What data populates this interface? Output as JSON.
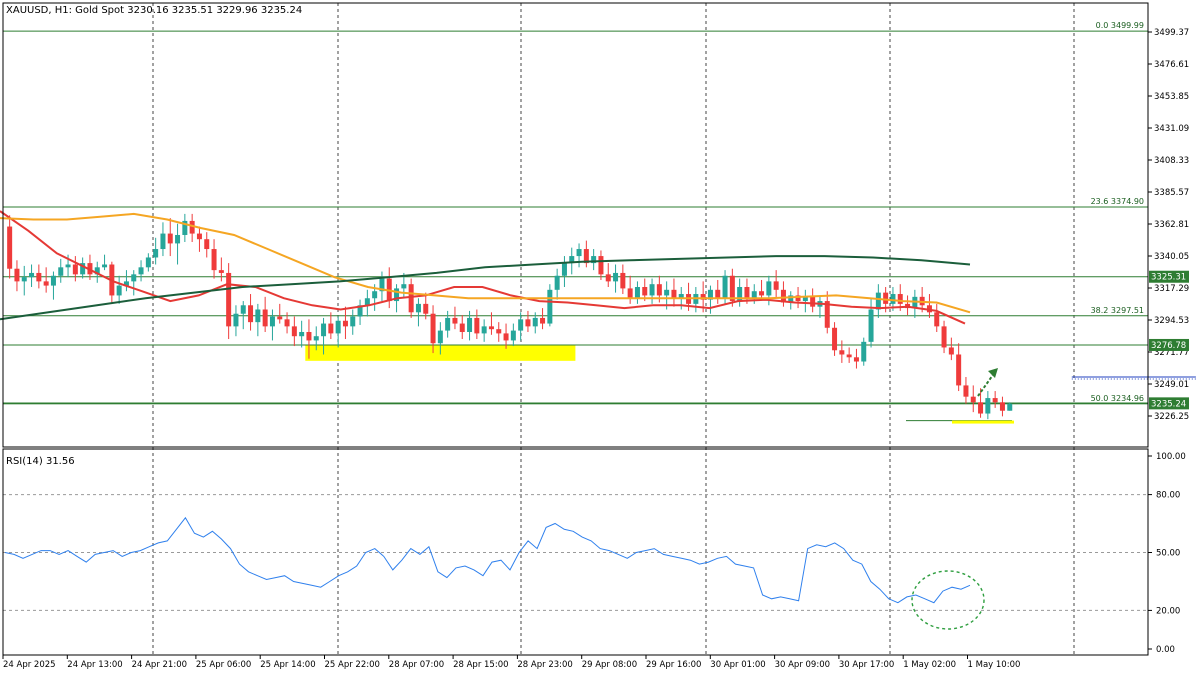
{
  "header": {
    "symbol_line": "XAUUSD, H1:  Gold Spot  3230.16 3235.51 3229.96 3235.24"
  },
  "colors": {
    "bull": "#26a69a",
    "bear": "#ef3b3b",
    "ma_fast": "#e53935",
    "ma_mid": "#f5a623",
    "ma_slow": "#1b5e3b",
    "fib": "#2e7d32",
    "zone": "#ffff00",
    "rsi": "#2f80ed",
    "arrow": "#2e7d32",
    "range_line": "#1f3fbf"
  },
  "chart_data": [
    {
      "type": "candlestick",
      "title": "XAUUSD, H1:  Gold Spot  3230.16 3235.51 3229.96 3235.24",
      "ylim": [
        3215,
        3515
      ],
      "y_ticks": [
        "3499.37",
        "3476.61",
        "3453.85",
        "3431.09",
        "3408.33",
        "3385.57",
        "3362.81",
        "3340.05",
        "3317.29",
        "3294.53",
        "3271.77",
        "3249.01",
        "3226.25"
      ],
      "x_ticks": [
        "24 Apr 2025",
        "24 Apr 13:00",
        "24 Apr 21:00",
        "25 Apr 06:00",
        "25 Apr 14:00",
        "25 Apr 22:00",
        "28 Apr 07:00",
        "28 Apr 15:00",
        "28 Apr 23:00",
        "29 Apr 08:00",
        "29 Apr 16:00",
        "30 Apr 01:00",
        "30 Apr 09:00",
        "30 Apr 17:00",
        "1 May 02:00",
        "1 May 10:00"
      ],
      "price_labels": [
        {
          "text": "3325.31",
          "value": 3325.31
        },
        {
          "text": "3276.78",
          "value": 3276.78
        },
        {
          "text": "3235.24",
          "value": 3235.24
        }
      ],
      "fib_levels": [
        {
          "label": "0.0 3499.99",
          "value": 3499.99
        },
        {
          "label": "23.6 3374.90",
          "value": 3374.9
        },
        {
          "label": "38.2 3297.51",
          "value": 3297.51
        },
        {
          "label": "50.0 3234.96",
          "value": 3234.96
        }
      ],
      "support_zone": {
        "from_bar": 41,
        "to_bar": 78,
        "y_low": 3265.5,
        "y_high": 3276.5
      },
      "range_line": {
        "from_bar": 146,
        "to_bar": 163,
        "value": 3254.0
      },
      "low_marker": {
        "from_bar": 150,
        "to_bar": 162,
        "value": 3223.0
      },
      "projection_arrow": {
        "from_bar": 154,
        "from_value": 3243.0,
        "to_bar": 163,
        "to_value": 3264.0
      },
      "series": [
        {
          "name": "",
          "style": "ma_fast",
          "values": [
            3372,
            3358,
            3342,
            3332,
            3322,
            3315,
            3308,
            3312,
            3320,
            3318,
            3310,
            3305,
            3302,
            3305,
            3310,
            3312,
            3318,
            3318,
            3312,
            3308,
            3307,
            3305,
            3303,
            3305,
            3305,
            3303,
            3308,
            3309,
            3307,
            3306,
            3304,
            3303,
            3304,
            3301,
            3292
          ]
        },
        {
          "name": "",
          "style": "ma_mid",
          "values": [
            3367,
            3366,
            3366,
            3368,
            3370,
            3366,
            3360,
            3355,
            3345,
            3335,
            3325,
            3318,
            3314,
            3312,
            3310,
            3310,
            3310,
            3310,
            3310,
            3310,
            3310,
            3310,
            3310,
            3310,
            3311,
            3312,
            3310,
            3308,
            3307,
            3300
          ]
        },
        {
          "name": "",
          "style": "ma_slow",
          "values": [
            3295,
            3300,
            3305,
            3310,
            3314,
            3318,
            3320,
            3322,
            3325,
            3328,
            3332,
            3334,
            3336,
            3337,
            3338,
            3339,
            3340,
            3340,
            3339,
            3337,
            3334
          ]
        }
      ],
      "candles": [
        [
          3361,
          3369,
          3324,
          3331
        ],
        [
          3331,
          3337,
          3315,
          3322
        ],
        [
          3322,
          3333,
          3312,
          3325
        ],
        [
          3325,
          3334,
          3318,
          3328
        ],
        [
          3328,
          3334,
          3317,
          3322
        ],
        [
          3322,
          3332,
          3314,
          3319
        ],
        [
          3319,
          3329,
          3309,
          3326
        ],
        [
          3326,
          3338,
          3321,
          3332
        ],
        [
          3332,
          3341,
          3325,
          3334
        ],
        [
          3334,
          3340,
          3322,
          3327
        ],
        [
          3327,
          3339,
          3324,
          3335
        ],
        [
          3335,
          3341,
          3323,
          3327
        ],
        [
          3327,
          3336,
          3321,
          3332
        ],
        [
          3332,
          3341,
          3330,
          3334
        ],
        [
          3334,
          3336,
          3307,
          3312
        ],
        [
          3312,
          3326,
          3306,
          3319
        ],
        [
          3319,
          3330,
          3315,
          3322
        ],
        [
          3322,
          3330,
          3312,
          3327
        ],
        [
          3327,
          3337,
          3322,
          3332
        ],
        [
          3332,
          3342,
          3329,
          3339
        ],
        [
          3339,
          3353,
          3334,
          3345
        ],
        [
          3345,
          3364,
          3340,
          3356
        ],
        [
          3356,
          3367,
          3340,
          3349
        ],
        [
          3349,
          3363,
          3334,
          3355
        ],
        [
          3355,
          3370,
          3350,
          3365
        ],
        [
          3365,
          3370,
          3350,
          3356
        ],
        [
          3356,
          3361,
          3343,
          3352
        ],
        [
          3352,
          3357,
          3339,
          3345
        ],
        [
          3345,
          3352,
          3324,
          3330
        ],
        [
          3330,
          3339,
          3322,
          3328
        ],
        [
          3328,
          3335,
          3281,
          3290
        ],
        [
          3290,
          3305,
          3283,
          3299
        ],
        [
          3299,
          3308,
          3288,
          3305
        ],
        [
          3305,
          3313,
          3287,
          3293
        ],
        [
          3293,
          3306,
          3283,
          3302
        ],
        [
          3302,
          3311,
          3286,
          3290
        ],
        [
          3290,
          3302,
          3280,
          3297
        ],
        [
          3297,
          3306,
          3292,
          3295
        ],
        [
          3295,
          3300,
          3285,
          3290
        ],
        [
          3290,
          3297,
          3276,
          3283
        ],
        [
          3283,
          3294,
          3275,
          3286
        ],
        [
          3286,
          3295,
          3267,
          3280
        ],
        [
          3280,
          3290,
          3273,
          3283
        ],
        [
          3283,
          3296,
          3270,
          3292
        ],
        [
          3292,
          3300,
          3281,
          3285
        ],
        [
          3285,
          3297,
          3275,
          3294
        ],
        [
          3294,
          3304,
          3281,
          3290
        ],
        [
          3290,
          3302,
          3284,
          3297
        ],
        [
          3297,
          3309,
          3291,
          3305
        ],
        [
          3305,
          3316,
          3297,
          3310
        ],
        [
          3310,
          3320,
          3301,
          3315
        ],
        [
          3315,
          3329,
          3308,
          3324
        ],
        [
          3324,
          3332,
          3303,
          3308
        ],
        [
          3308,
          3320,
          3300,
          3317
        ],
        [
          3317,
          3328,
          3310,
          3320
        ],
        [
          3320,
          3324,
          3296,
          3300
        ],
        [
          3300,
          3310,
          3290,
          3306
        ],
        [
          3306,
          3314,
          3295,
          3299
        ],
        [
          3299,
          3305,
          3271,
          3278
        ],
        [
          3278,
          3293,
          3270,
          3287
        ],
        [
          3287,
          3301,
          3282,
          3296
        ],
        [
          3296,
          3304,
          3288,
          3292
        ],
        [
          3292,
          3298,
          3281,
          3286
        ],
        [
          3286,
          3301,
          3280,
          3296
        ],
        [
          3296,
          3302,
          3281,
          3285
        ],
        [
          3285,
          3295,
          3279,
          3290
        ],
        [
          3290,
          3300,
          3284,
          3288
        ],
        [
          3288,
          3293,
          3279,
          3285
        ],
        [
          3285,
          3292,
          3274,
          3280
        ],
        [
          3280,
          3292,
          3276,
          3287
        ],
        [
          3287,
          3300,
          3280,
          3295
        ],
        [
          3295,
          3301,
          3286,
          3290
        ],
        [
          3290,
          3300,
          3285,
          3296
        ],
        [
          3296,
          3303,
          3288,
          3292
        ],
        [
          3292,
          3320,
          3290,
          3316
        ],
        [
          3316,
          3331,
          3309,
          3326
        ],
        [
          3326,
          3340,
          3318,
          3335
        ],
        [
          3335,
          3346,
          3327,
          3340
        ],
        [
          3340,
          3349,
          3332,
          3345
        ],
        [
          3345,
          3351,
          3332,
          3335
        ],
        [
          3335,
          3345,
          3330,
          3340
        ],
        [
          3340,
          3344,
          3323,
          3327
        ],
        [
          3327,
          3335,
          3318,
          3322
        ],
        [
          3322,
          3334,
          3314,
          3328
        ],
        [
          3328,
          3334,
          3313,
          3317
        ],
        [
          3317,
          3326,
          3306,
          3310
        ],
        [
          3310,
          3322,
          3306,
          3318
        ],
        [
          3318,
          3324,
          3308,
          3312
        ],
        [
          3312,
          3324,
          3306,
          3320
        ],
        [
          3320,
          3326,
          3307,
          3312
        ],
        [
          3312,
          3322,
          3302,
          3316
        ],
        [
          3316,
          3324,
          3304,
          3310
        ],
        [
          3310,
          3318,
          3302,
          3313
        ],
        [
          3313,
          3321,
          3301,
          3306
        ],
        [
          3306,
          3318,
          3300,
          3313
        ],
        [
          3313,
          3322,
          3300,
          3309
        ],
        [
          3309,
          3319,
          3299,
          3316
        ],
        [
          3316,
          3323,
          3306,
          3310
        ],
        [
          3310,
          3330,
          3306,
          3326
        ],
        [
          3326,
          3331,
          3304,
          3308
        ],
        [
          3308,
          3324,
          3304,
          3318
        ],
        [
          3318,
          3324,
          3306,
          3310
        ],
        [
          3310,
          3320,
          3306,
          3315
        ],
        [
          3315,
          3323,
          3309,
          3312
        ],
        [
          3312,
          3326,
          3305,
          3322
        ],
        [
          3322,
          3330,
          3310,
          3316
        ],
        [
          3316,
          3322,
          3304,
          3307
        ],
        [
          3307,
          3315,
          3302,
          3312
        ],
        [
          3312,
          3318,
          3303,
          3308
        ],
        [
          3308,
          3316,
          3300,
          3311
        ],
        [
          3311,
          3317,
          3300,
          3304
        ],
        [
          3304,
          3312,
          3296,
          3308
        ],
        [
          3308,
          3315,
          3285,
          3289
        ],
        [
          3289,
          3293,
          3269,
          3273
        ],
        [
          3273,
          3280,
          3264,
          3270
        ],
        [
          3270,
          3275,
          3264,
          3268
        ],
        [
          3268,
          3274,
          3260,
          3265
        ],
        [
          3265,
          3282,
          3262,
          3279
        ],
        [
          3279,
          3310,
          3275,
          3302
        ],
        [
          3302,
          3320,
          3296,
          3314
        ],
        [
          3314,
          3318,
          3300,
          3306
        ],
        [
          3306,
          3318,
          3301,
          3313
        ],
        [
          3313,
          3320,
          3301,
          3306
        ],
        [
          3306,
          3312,
          3298,
          3303
        ],
        [
          3303,
          3316,
          3296,
          3311
        ],
        [
          3311,
          3318,
          3300,
          3305
        ],
        [
          3305,
          3313,
          3296,
          3300
        ],
        [
          3300,
          3306,
          3286,
          3290
        ],
        [
          3290,
          3294,
          3271,
          3275
        ],
        [
          3275,
          3282,
          3266,
          3270
        ],
        [
          3270,
          3278,
          3244,
          3248
        ],
        [
          3248,
          3254,
          3235,
          3240
        ],
        [
          3240,
          3248,
          3229,
          3236
        ],
        [
          3236,
          3246,
          3225,
          3228
        ],
        [
          3228,
          3244,
          3224,
          3239
        ],
        [
          3239,
          3244,
          3232,
          3236
        ],
        [
          3236,
          3240,
          3226,
          3230
        ],
        [
          3230,
          3236,
          3230,
          3235
        ]
      ]
    },
    {
      "type": "line",
      "title": "RSI(14) 31.56",
      "ylim": [
        0,
        100
      ],
      "y_ticks": [
        "100.00",
        "80.00",
        "50.00",
        "20.00",
        "0.00"
      ],
      "series": [
        {
          "name": "",
          "values": [
            50,
            49,
            47,
            49,
            51,
            51,
            49,
            51,
            48,
            45,
            49,
            50,
            51,
            48,
            50,
            51,
            53,
            55,
            56,
            62,
            68,
            60,
            58,
            61,
            57,
            52,
            44,
            40,
            38,
            36,
            37,
            38,
            35,
            34,
            33,
            32,
            35,
            38,
            40,
            43,
            50,
            52,
            48,
            41,
            46,
            52,
            49,
            53,
            40,
            37,
            42,
            43,
            41,
            38,
            45,
            46,
            41,
            50,
            56,
            52,
            63,
            65,
            62,
            61,
            58,
            56,
            52,
            51,
            49,
            47,
            50,
            51,
            52,
            49,
            48,
            47,
            46,
            44,
            45,
            47,
            48,
            44,
            43,
            42,
            28,
            26,
            27,
            26,
            25,
            52,
            54,
            53,
            55,
            52,
            46,
            44,
            35,
            31,
            26,
            24,
            27,
            28,
            26,
            24,
            30,
            32,
            31,
            33
          ]
        }
      ]
    }
  ]
}
